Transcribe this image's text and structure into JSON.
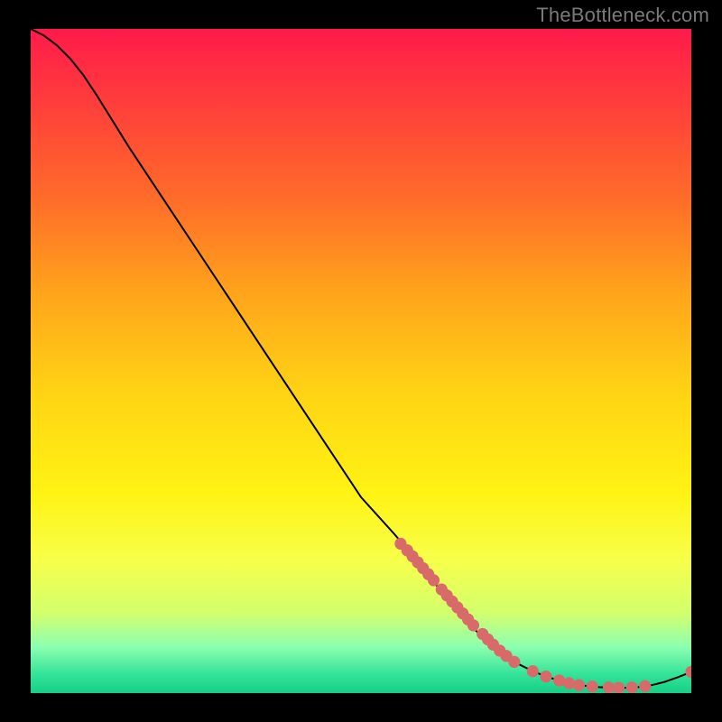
{
  "watermark": "TheBottleneck.com",
  "chart_data": {
    "type": "line",
    "title": "",
    "xlabel": "",
    "ylabel": "",
    "xlim": [
      0,
      100
    ],
    "ylim": [
      0,
      100
    ],
    "grid": false,
    "legend": false,
    "curve": [
      {
        "x": 0,
        "y": 100
      },
      {
        "x": 2,
        "y": 99
      },
      {
        "x": 4,
        "y": 97.5
      },
      {
        "x": 6,
        "y": 95.5
      },
      {
        "x": 8,
        "y": 93
      },
      {
        "x": 10,
        "y": 90
      },
      {
        "x": 15,
        "y": 82
      },
      {
        "x": 20,
        "y": 74.5
      },
      {
        "x": 25,
        "y": 67
      },
      {
        "x": 30,
        "y": 59.5
      },
      {
        "x": 35,
        "y": 52
      },
      {
        "x": 40,
        "y": 44.5
      },
      {
        "x": 45,
        "y": 37
      },
      {
        "x": 50,
        "y": 29.5
      },
      {
        "x": 55,
        "y": 24
      },
      {
        "x": 58,
        "y": 20.5
      },
      {
        "x": 60,
        "y": 18
      },
      {
        "x": 62,
        "y": 15.5
      },
      {
        "x": 64,
        "y": 13
      },
      {
        "x": 66,
        "y": 10.8
      },
      {
        "x": 68,
        "y": 8.8
      },
      {
        "x": 70,
        "y": 7
      },
      {
        "x": 72,
        "y": 5.5
      },
      {
        "x": 74,
        "y": 4.3
      },
      {
        "x": 76,
        "y": 3.3
      },
      {
        "x": 78,
        "y": 2.5
      },
      {
        "x": 80,
        "y": 1.9
      },
      {
        "x": 82,
        "y": 1.4
      },
      {
        "x": 84,
        "y": 1.1
      },
      {
        "x": 86,
        "y": 0.9
      },
      {
        "x": 88,
        "y": 0.8
      },
      {
        "x": 90,
        "y": 0.8
      },
      {
        "x": 92,
        "y": 0.9
      },
      {
        "x": 94,
        "y": 1.2
      },
      {
        "x": 96,
        "y": 1.7
      },
      {
        "x": 98,
        "y": 2.4
      },
      {
        "x": 100,
        "y": 3.2
      }
    ],
    "points": [
      {
        "x": 56,
        "y": 22.5
      },
      {
        "x": 57,
        "y": 21.5
      },
      {
        "x": 57.8,
        "y": 20.6
      },
      {
        "x": 58.6,
        "y": 19.7
      },
      {
        "x": 59.4,
        "y": 18.8
      },
      {
        "x": 60.2,
        "y": 17.9
      },
      {
        "x": 61,
        "y": 17
      },
      {
        "x": 62.2,
        "y": 15.6
      },
      {
        "x": 63,
        "y": 14.7
      },
      {
        "x": 63.8,
        "y": 13.8
      },
      {
        "x": 64.6,
        "y": 12.9
      },
      {
        "x": 65.4,
        "y": 12
      },
      {
        "x": 66.2,
        "y": 11.1
      },
      {
        "x": 67,
        "y": 10.2
      },
      {
        "x": 68.4,
        "y": 8.9
      },
      {
        "x": 69.2,
        "y": 8.1
      },
      {
        "x": 70,
        "y": 7.3
      },
      {
        "x": 71,
        "y": 6.4
      },
      {
        "x": 72,
        "y": 5.6
      },
      {
        "x": 73.2,
        "y": 4.7
      },
      {
        "x": 76,
        "y": 3.3
      },
      {
        "x": 78,
        "y": 2.5
      },
      {
        "x": 80,
        "y": 1.9
      },
      {
        "x": 81.5,
        "y": 1.5
      },
      {
        "x": 83,
        "y": 1.2
      },
      {
        "x": 85,
        "y": 1.0
      },
      {
        "x": 87.5,
        "y": 0.85
      },
      {
        "x": 89,
        "y": 0.8
      },
      {
        "x": 91,
        "y": 0.85
      },
      {
        "x": 93,
        "y": 1.05
      },
      {
        "x": 100,
        "y": 3.2
      }
    ],
    "colors": {
      "curve": "#000000",
      "points": "#d86a6a",
      "gradient_top": "#ff1a4b",
      "gradient_mid": "#fff314",
      "gradient_bottom": "#16cf86"
    }
  }
}
